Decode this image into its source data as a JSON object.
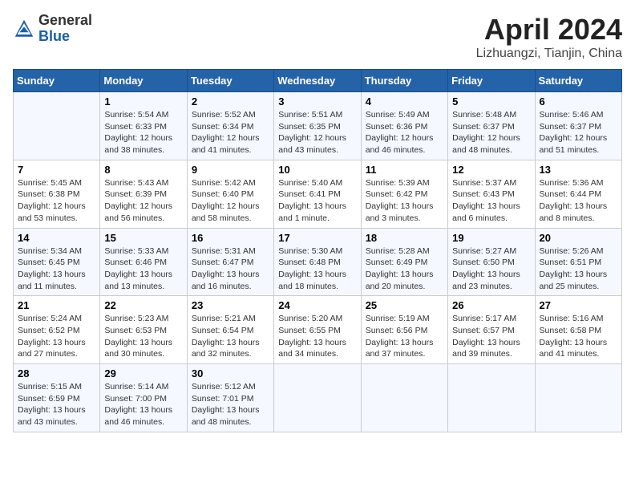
{
  "header": {
    "logo_general": "General",
    "logo_blue": "Blue",
    "month_title": "April 2024",
    "location": "Lizhuangzi, Tianjin, China"
  },
  "days_of_week": [
    "Sunday",
    "Monday",
    "Tuesday",
    "Wednesday",
    "Thursday",
    "Friday",
    "Saturday"
  ],
  "weeks": [
    [
      {
        "day": "",
        "info": ""
      },
      {
        "day": "1",
        "info": "Sunrise: 5:54 AM\nSunset: 6:33 PM\nDaylight: 12 hours\nand 38 minutes."
      },
      {
        "day": "2",
        "info": "Sunrise: 5:52 AM\nSunset: 6:34 PM\nDaylight: 12 hours\nand 41 minutes."
      },
      {
        "day": "3",
        "info": "Sunrise: 5:51 AM\nSunset: 6:35 PM\nDaylight: 12 hours\nand 43 minutes."
      },
      {
        "day": "4",
        "info": "Sunrise: 5:49 AM\nSunset: 6:36 PM\nDaylight: 12 hours\nand 46 minutes."
      },
      {
        "day": "5",
        "info": "Sunrise: 5:48 AM\nSunset: 6:37 PM\nDaylight: 12 hours\nand 48 minutes."
      },
      {
        "day": "6",
        "info": "Sunrise: 5:46 AM\nSunset: 6:37 PM\nDaylight: 12 hours\nand 51 minutes."
      }
    ],
    [
      {
        "day": "7",
        "info": "Sunrise: 5:45 AM\nSunset: 6:38 PM\nDaylight: 12 hours\nand 53 minutes."
      },
      {
        "day": "8",
        "info": "Sunrise: 5:43 AM\nSunset: 6:39 PM\nDaylight: 12 hours\nand 56 minutes."
      },
      {
        "day": "9",
        "info": "Sunrise: 5:42 AM\nSunset: 6:40 PM\nDaylight: 12 hours\nand 58 minutes."
      },
      {
        "day": "10",
        "info": "Sunrise: 5:40 AM\nSunset: 6:41 PM\nDaylight: 13 hours\nand 1 minute."
      },
      {
        "day": "11",
        "info": "Sunrise: 5:39 AM\nSunset: 6:42 PM\nDaylight: 13 hours\nand 3 minutes."
      },
      {
        "day": "12",
        "info": "Sunrise: 5:37 AM\nSunset: 6:43 PM\nDaylight: 13 hours\nand 6 minutes."
      },
      {
        "day": "13",
        "info": "Sunrise: 5:36 AM\nSunset: 6:44 PM\nDaylight: 13 hours\nand 8 minutes."
      }
    ],
    [
      {
        "day": "14",
        "info": "Sunrise: 5:34 AM\nSunset: 6:45 PM\nDaylight: 13 hours\nand 11 minutes."
      },
      {
        "day": "15",
        "info": "Sunrise: 5:33 AM\nSunset: 6:46 PM\nDaylight: 13 hours\nand 13 minutes."
      },
      {
        "day": "16",
        "info": "Sunrise: 5:31 AM\nSunset: 6:47 PM\nDaylight: 13 hours\nand 16 minutes."
      },
      {
        "day": "17",
        "info": "Sunrise: 5:30 AM\nSunset: 6:48 PM\nDaylight: 13 hours\nand 18 minutes."
      },
      {
        "day": "18",
        "info": "Sunrise: 5:28 AM\nSunset: 6:49 PM\nDaylight: 13 hours\nand 20 minutes."
      },
      {
        "day": "19",
        "info": "Sunrise: 5:27 AM\nSunset: 6:50 PM\nDaylight: 13 hours\nand 23 minutes."
      },
      {
        "day": "20",
        "info": "Sunrise: 5:26 AM\nSunset: 6:51 PM\nDaylight: 13 hours\nand 25 minutes."
      }
    ],
    [
      {
        "day": "21",
        "info": "Sunrise: 5:24 AM\nSunset: 6:52 PM\nDaylight: 13 hours\nand 27 minutes."
      },
      {
        "day": "22",
        "info": "Sunrise: 5:23 AM\nSunset: 6:53 PM\nDaylight: 13 hours\nand 30 minutes."
      },
      {
        "day": "23",
        "info": "Sunrise: 5:21 AM\nSunset: 6:54 PM\nDaylight: 13 hours\nand 32 minutes."
      },
      {
        "day": "24",
        "info": "Sunrise: 5:20 AM\nSunset: 6:55 PM\nDaylight: 13 hours\nand 34 minutes."
      },
      {
        "day": "25",
        "info": "Sunrise: 5:19 AM\nSunset: 6:56 PM\nDaylight: 13 hours\nand 37 minutes."
      },
      {
        "day": "26",
        "info": "Sunrise: 5:17 AM\nSunset: 6:57 PM\nDaylight: 13 hours\nand 39 minutes."
      },
      {
        "day": "27",
        "info": "Sunrise: 5:16 AM\nSunset: 6:58 PM\nDaylight: 13 hours\nand 41 minutes."
      }
    ],
    [
      {
        "day": "28",
        "info": "Sunrise: 5:15 AM\nSunset: 6:59 PM\nDaylight: 13 hours\nand 43 minutes."
      },
      {
        "day": "29",
        "info": "Sunrise: 5:14 AM\nSunset: 7:00 PM\nDaylight: 13 hours\nand 46 minutes."
      },
      {
        "day": "30",
        "info": "Sunrise: 5:12 AM\nSunset: 7:01 PM\nDaylight: 13 hours\nand 48 minutes."
      },
      {
        "day": "",
        "info": ""
      },
      {
        "day": "",
        "info": ""
      },
      {
        "day": "",
        "info": ""
      },
      {
        "day": "",
        "info": ""
      }
    ]
  ]
}
